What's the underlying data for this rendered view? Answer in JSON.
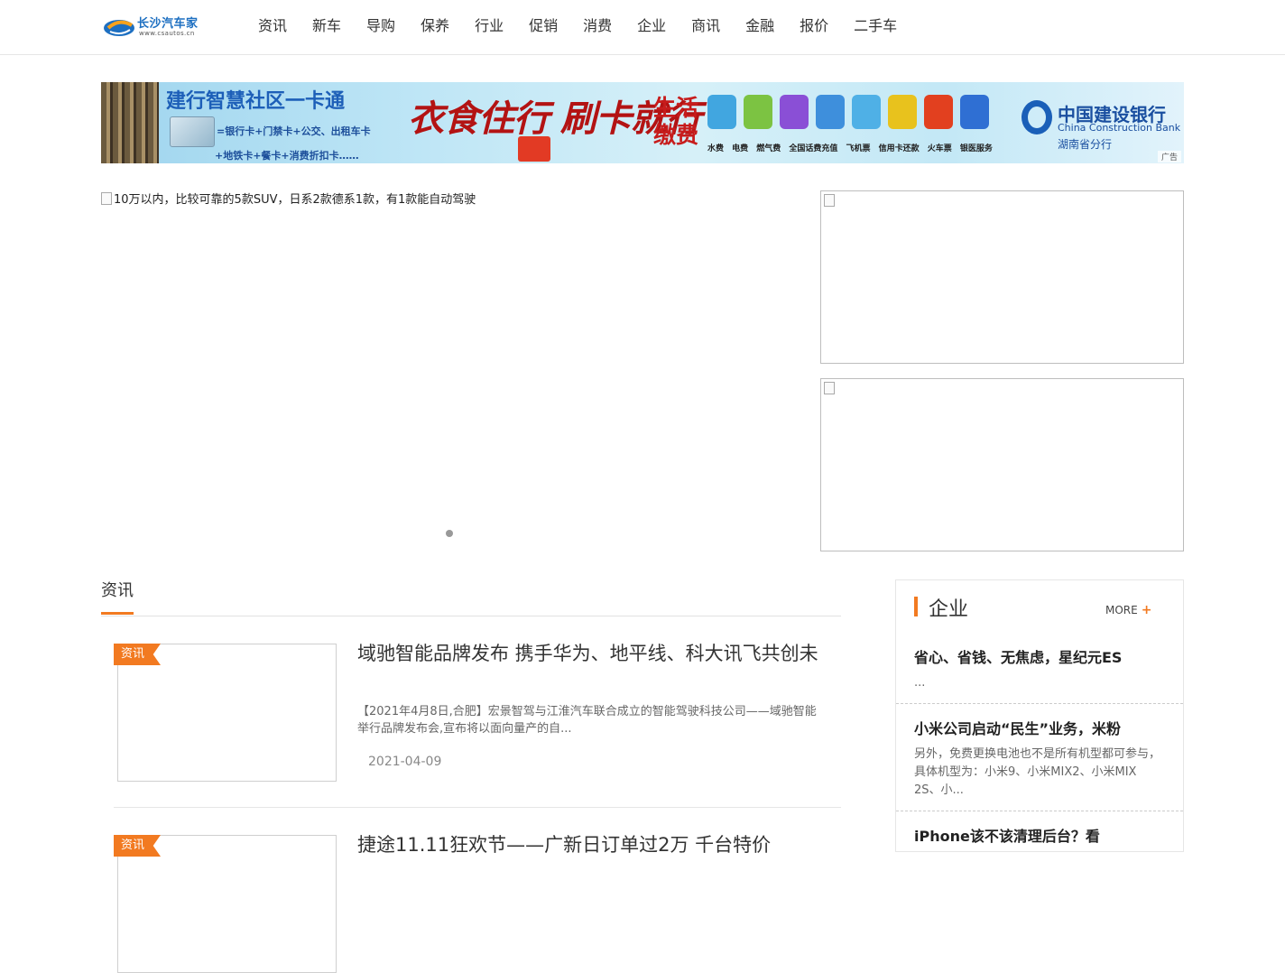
{
  "header": {
    "logo_text": "长沙汽车家",
    "logo_url": "www.csautos.cn",
    "nav": [
      "资讯",
      "新车",
      "导购",
      "保养",
      "行业",
      "促销",
      "消费",
      "企业",
      "商讯",
      "金融",
      "报价",
      "二手车"
    ]
  },
  "banner": {
    "title": "建行智慧社区一卡通",
    "line1": "=银行卡+门禁卡+公交、出租车卡",
    "line2": "+地铁卡+餐卡+消费折扣卡……",
    "slogan": "衣食住行 刷卡就行",
    "life_pay": "生活缴费",
    "service_labels": "水费 电费 燃气费 全国话费充值 飞机票 信用卡还款 火车票 银医服务",
    "bank_name": "中国建设银行",
    "bank_en": "China Construction Bank",
    "bank_branch": "湖南省分行",
    "ad_label": "广告",
    "icon_colors": [
      "#41a6e0",
      "#7cc342",
      "#8a4fd6",
      "#3e8fdc",
      "#4fb0e6",
      "#e8c21d",
      "#e2401f",
      "#2f6fd3"
    ]
  },
  "slider": {
    "alt": "10万以内，比较可靠的5款SUV，日系2款德系1款，有1款能自动驾驶"
  },
  "news": {
    "section_title": "资讯",
    "articles": [
      {
        "tag": "资讯",
        "title": "域驰智能品牌发布 携手华为、地平线、科大讯飞共创未",
        "desc": "【2021年4月8日,合肥】宏景智驾与江淮汽车联合成立的智能驾驶科技公司——域驰智能举行品牌发布会,宣布将以面向量产的自...",
        "date": "2021-04-09"
      },
      {
        "tag": "资讯",
        "title": "捷途11.11狂欢节——广新日订单过2万 千台特价",
        "desc": "",
        "date": ""
      }
    ]
  },
  "aside": {
    "title": "企业",
    "more": "MORE",
    "items": [
      {
        "title": "省心、省钱、无焦虑，星纪元ES",
        "desc": "..."
      },
      {
        "title": "小米公司启动“民生”业务，米粉",
        "desc": "另外，免费更换电池也不是所有机型都可参与，具体机型为：小米9、小米MIX2、小米MIX 2S、小..."
      },
      {
        "title": "iPhone该不该清理后台？看",
        "desc": ""
      }
    ]
  },
  "colors": {
    "accent": "#f27a21",
    "brand": "#1d6fc1"
  }
}
